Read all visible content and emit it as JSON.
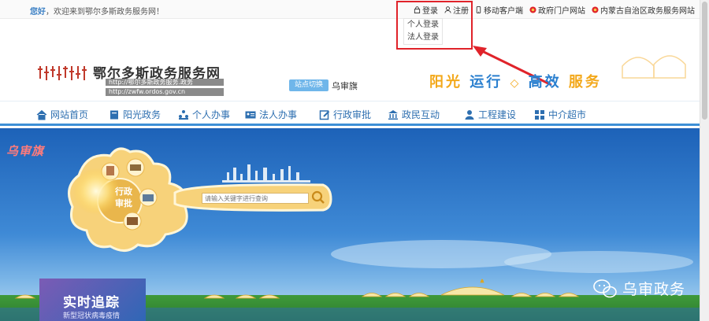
{
  "topbar": {
    "welcome_bold": "您好",
    "welcome_text": "，欢迎来到鄂尔多斯政务服务网！",
    "login": "登录",
    "register": "注册",
    "mobile": "移动客户端",
    "gov_portal": "政府门户网站",
    "region_site": "内蒙古自治区政务服务网站"
  },
  "login_dropdown": [
    "个人登录",
    "法人登录"
  ],
  "header": {
    "title": "鄂尔多斯政务服务网",
    "subtitle": "http://鄂尔多斯政务服务.政务",
    "url": "http://zwfw.ordos.gov.cn",
    "switch_label": "站点切换",
    "switch_value": "乌审旗",
    "slogan": [
      "阳光",
      "运行",
      "◇",
      "高效",
      "服务"
    ]
  },
  "nav": [
    {
      "label": "网站首页",
      "icon": "home-icon"
    },
    {
      "label": "阳光政务",
      "icon": "book-icon"
    },
    {
      "label": "个人办事",
      "icon": "people-icon"
    },
    {
      "label": "法人办事",
      "icon": "id-card-icon"
    },
    {
      "label": "行政审批",
      "icon": "edit-icon"
    },
    {
      "label": "政民互动",
      "icon": "building-icon"
    },
    {
      "label": "工程建设",
      "icon": "user-icon"
    },
    {
      "label": "中介超市",
      "icon": "grid-icon"
    }
  ],
  "banner": {
    "tag": "乌审旗",
    "seal_line1": "行政",
    "seal_line2": "审批",
    "search_placeholder": "请输入关键字进行查询",
    "promo_title": "实时追踪",
    "promo_sub": "新型冠状病毒疫情",
    "wechat_name": "乌审政务"
  },
  "colors": {
    "accent_blue": "#3d8fd6",
    "nav_text": "#2e6fb0",
    "highlight_red": "#e0232a",
    "slogan_orange": "#f3a81a"
  }
}
